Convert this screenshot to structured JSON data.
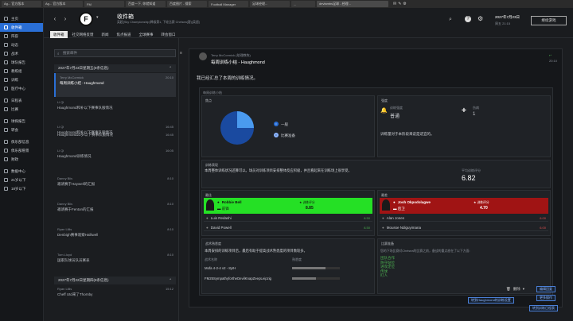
{
  "taskbar": {
    "tabs": [
      "Ag... 官方版本",
      "Ag... 官方版本",
      "FM",
      "百度一下, 你就知道",
      "百度图片 - 搜索",
      "Football Manager",
      "足球经理...",
      "...",
      "devlambs足球 - 经理..."
    ],
    "extra_icons": [
      "✉",
      "✎",
      "⚙"
    ]
  },
  "sidebar": {
    "items": [
      {
        "label": "主页",
        "icon": "home-icon",
        "active": false
      },
      {
        "label": "收件箱",
        "icon": "inbox-icon",
        "active": true
      },
      {
        "label": "阵容",
        "icon": "squad-icon",
        "active": false
      },
      {
        "label": "动态",
        "icon": "dynamics-icon",
        "active": false
      },
      {
        "label": "战术",
        "icon": "tactics-icon",
        "active": false
      },
      {
        "label": "球队报告",
        "icon": "team-report-icon",
        "active": false
      },
      {
        "label": "教练组",
        "icon": "staff-icon",
        "active": false
      },
      {
        "label": "训练",
        "icon": "training-icon",
        "active": false
      },
      {
        "label": "医疗中心",
        "icon": "medical-icon",
        "active": false
      },
      {
        "label": "日程表",
        "icon": "schedule-icon",
        "active": false
      },
      {
        "label": "比赛",
        "icon": "match-icon",
        "active": false
      },
      {
        "label": "球探报告",
        "icon": "scouting-icon",
        "active": false
      },
      {
        "label": "转会",
        "icon": "transfer-icon",
        "active": false
      },
      {
        "label": "俱乐部信息",
        "icon": "club-info-icon",
        "active": false
      },
      {
        "label": "俱乐部愿景",
        "icon": "club-vision-icon",
        "active": false
      },
      {
        "label": "财政",
        "icon": "finances-icon",
        "active": false
      },
      {
        "label": "数据中心",
        "icon": "data-hub-icon",
        "active": false
      },
      {
        "label": "21岁以下",
        "icon": "u21-icon",
        "active": false
      },
      {
        "label": "18岁以下",
        "icon": "u18-icon",
        "active": false
      }
    ]
  },
  "topbar": {
    "title": "收件箱",
    "subtitle": "英超(Sky Championship)降级第1, 下轮比赛 Chelsea(客)(英超)",
    "tabs": [
      "收件箱",
      "社交网络反馈",
      "新闻",
      "焦点报道",
      "全球赛事",
      "转会窗口"
    ],
    "date": "2027年7月23日",
    "day_time": "周五 21:15",
    "continue_label": "继续游戏",
    "logo_text": "F"
  },
  "list": {
    "search_placeholder": "搜索邮件",
    "date_header_1": "2027年7月23日星期五(8条信息)",
    "date_header_2": "2027年7月22日星期四(8条信息)",
    "messages": [
      {
        "from": "Terry McCormick",
        "subject": "每周训练小结 - Haughmond",
        "time": "20:10",
        "selected": true
      },
      {
        "from": "Li Qi",
        "subject": "Haughmond和补以下赛事队服情况",
        "time": "",
        "selected": false
      },
      {
        "from": "Li Qi",
        "subject": "Haughmond和补以下赛事队服情况",
        "time": "16:45",
        "selected": false
      },
      {
        "from": "Li Qi",
        "subject": "Haughmond23岁以下赛事队服情况",
        "time": "16:45",
        "selected": false
      },
      {
        "from": "Li Qi",
        "subject": "Haughmond训练情况",
        "time": "16:05",
        "selected": false
      },
      {
        "from": "Danny Biis",
        "subject": "邀请赛于Haywell的汇报",
        "time": "8:10",
        "selected": false
      },
      {
        "from": "Danny Biis",
        "subject": "邀请赛于Fenton的汇报",
        "time": "8:10",
        "selected": false
      },
      {
        "from": "Ryan Lillis",
        "subject": "Denbigh赛事观察Halliwell",
        "time": "8:10",
        "selected": false
      },
      {
        "from": "Tom Lloyd",
        "subject": "国家队球员队员赛表",
        "time": "8:10",
        "selected": false
      },
      {
        "from": "Ryan Lillis",
        "subject": "Cheff Utd来了Thornby",
        "time": "15:12",
        "selected": false
      }
    ]
  },
  "detail": {
    "sender": "Terry McCormick (助理教练)",
    "subject": "每周训练小结 - Haughmond",
    "time": "20:10",
    "intro": "我已经汇总了本周的训练情况。",
    "section_title": "每周训练小结",
    "focus": {
      "title": "焦点",
      "legend": [
        {
          "label": "一般",
          "color": "#2a6fd6"
        },
        {
          "label": "比赛准备",
          "color": "#8ab4ff"
        }
      ],
      "pie": [
        75,
        25
      ]
    },
    "intensity": {
      "title": "强度",
      "label_a": "训练强度",
      "value_a": "普通",
      "label_b": "伤病",
      "value_b": "1",
      "comment": "训练量对于本阶段来说是适宜的。"
    },
    "rating": {
      "title": "训练表现",
      "comment": "本周整体训练状况还算可以。球员对训练项目安排整体反应积极，并且看起来在训练场上很享受。",
      "avg_label": "平均训练评分",
      "avg_value": "6.82"
    },
    "best": {
      "title": "最佳",
      "top_name": "Robbie Bell",
      "top_role": "前锋",
      "top_rating_label": "训练评分",
      "top_rating": "8.85",
      "rows": [
        {
          "name": "Luis Redashi",
          "rating": "8.50"
        },
        {
          "name": "David Powell",
          "rating": "8.50"
        }
      ]
    },
    "worst": {
      "title": "最差",
      "top_name": "Josh Okpodolagwe",
      "top_role": "后卫",
      "top_rating_label": "训练评分",
      "top_rating": "4.70",
      "rows": [
        {
          "name": "Alan Jones",
          "rating": "6.00"
        },
        {
          "name": "Mousse Ndiguyimana",
          "rating": "6.00"
        }
      ]
    },
    "tactics": {
      "title": "战术熟悉度",
      "comment": "本周安排的训练项目后，最后有助于提高战术熟悉度的项目数较多。",
      "header_name": "战术名称",
      "header_value": "熟悉度",
      "rows": [
        {
          "name": "Mofa 4-2-4 v2 - 8yrH",
          "level": 0.7
        },
        {
          "name": "FM25SympathyfortheDevilKnapZeepLeipzig",
          "level": 0.5
        }
      ]
    },
    "upcoming": {
      "title": "比赛准备",
      "comment": "您的下场比赛对Chelsea的比赛之前，备战的重点放在了以下方面:",
      "items": [
        "团队合作",
        "防守站位",
        "进攻定位",
        "传球",
        "盯人"
      ]
    },
    "actions": {
      "reply_button": "编辑回复",
      "more_button": "更多操作",
      "delete_label": "删除",
      "go_training_button": "转到Haughmond的训练设置",
      "go_schedule_button": "转到训练日程表"
    }
  }
}
